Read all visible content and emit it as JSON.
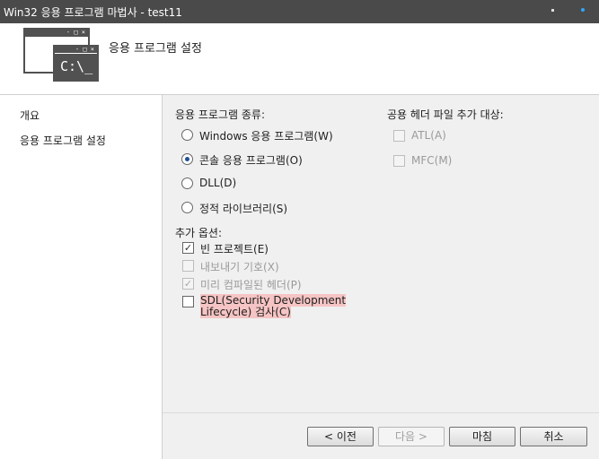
{
  "window": {
    "title": "Win32 응용 프로그램 마법사 - test11"
  },
  "header": {
    "title": "응용 프로그램 설정",
    "icon_text": "C:\\_",
    "window_controls": "- □ ×"
  },
  "sidebar": {
    "items": [
      {
        "label": "개요"
      },
      {
        "label": "응용 프로그램 설정"
      }
    ]
  },
  "app_type": {
    "label": "응용 프로그램 종류:",
    "options": [
      {
        "label": "Windows 응용 프로그램(W)",
        "selected": false
      },
      {
        "label": "콘솔 응용 프로그램(O)",
        "selected": true
      },
      {
        "label": "DLL(D)",
        "selected": false
      },
      {
        "label": "정적 라이브러리(S)",
        "selected": false
      }
    ]
  },
  "common_headers": {
    "label": "공용 헤더 파일 추가 대상:",
    "options": [
      {
        "label": "ATL(A)",
        "checked": false,
        "disabled": true
      },
      {
        "label": "MFC(M)",
        "checked": false,
        "disabled": true
      }
    ]
  },
  "additional_options": {
    "label": "추가 옵션:",
    "options": [
      {
        "label": "빈 프로젝트(E)",
        "checked": true,
        "disabled": false
      },
      {
        "label": "내보내기 기호(X)",
        "checked": false,
        "disabled": true
      },
      {
        "label": "미리 컴파일된 헤더(P)",
        "checked": true,
        "disabled": true
      },
      {
        "label_line1": "SDL(Security Development",
        "label_line2": "Lifecycle) 검사(C)",
        "checked": false,
        "disabled": false
      }
    ]
  },
  "check_mark": "✓",
  "buttons": {
    "prev": "< 이전",
    "next": "다음 >",
    "finish": "마침",
    "cancel": "취소"
  },
  "colors": {
    "titlebar": "#4a4a4a",
    "panel": "#f0f0f0",
    "highlight": "#f6c4c4"
  }
}
